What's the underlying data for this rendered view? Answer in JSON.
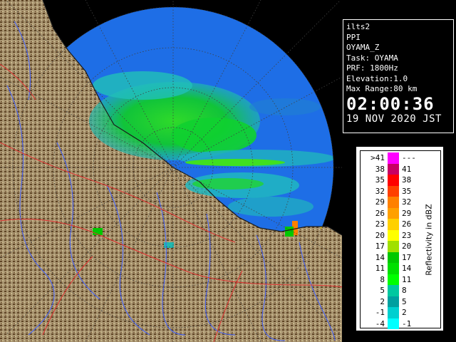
{
  "info_panel": {
    "lines": [
      "ilts2",
      "PPI",
      "OYAMA_Z",
      "Task: OYAMA",
      "PRF: 1800Hz",
      "Elevation:1.0",
      "Max Range:80 km"
    ],
    "time": "02:00:36",
    "date": "19 NOV 2020 JST"
  },
  "legend": {
    "title": "Reflectivity in dBZ",
    "rows": [
      {
        "lo": ">41",
        "hi": "---",
        "color": "#ff00ff"
      },
      {
        "lo": "38",
        "hi": "41",
        "color": "#c80064"
      },
      {
        "lo": "35",
        "hi": "38",
        "color": "#ff0000"
      },
      {
        "lo": "32",
        "hi": "35",
        "color": "#ff4000"
      },
      {
        "lo": "29",
        "hi": "32",
        "color": "#ff8000"
      },
      {
        "lo": "26",
        "hi": "29",
        "color": "#ffa000"
      },
      {
        "lo": "23",
        "hi": "26",
        "color": "#ffd000"
      },
      {
        "lo": "20",
        "hi": "23",
        "color": "#ffff00"
      },
      {
        "lo": "17",
        "hi": "20",
        "color": "#a0e000"
      },
      {
        "lo": "14",
        "hi": "17",
        "color": "#00c800"
      },
      {
        "lo": "11",
        "hi": "14",
        "color": "#00e000"
      },
      {
        "lo": "8",
        "hi": "11",
        "color": "#00ff00"
      },
      {
        "lo": "5",
        "hi": "8",
        "color": "#00c8a0"
      },
      {
        "lo": "2",
        "hi": "5",
        "color": "#00a0a0"
      },
      {
        "lo": "-1",
        "hi": "2",
        "color": "#00d0d0"
      },
      {
        "lo": "-4",
        "hi": "-1",
        "color": "#00ffff"
      }
    ]
  },
  "colors": {
    "range_circle": "#1e6ee6",
    "sea": "#000000",
    "land_light": "#b0a080",
    "land_dark": "#5a4020",
    "rivers": "#4060ff",
    "borders": "#e03030",
    "echo_weak": "#20c8c0",
    "echo_mid": "#10d020",
    "echo_strong": "#60ff20"
  }
}
